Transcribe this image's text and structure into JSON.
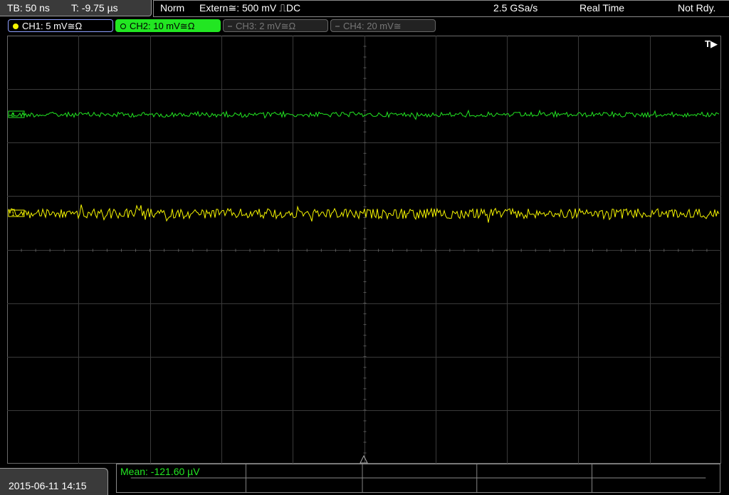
{
  "topbar": {
    "timebase": "TB: 50 ns",
    "trigger_time": "T: -9.75 µs",
    "trigger_mode": "Norm",
    "trigger_source": "Extern≅: 500 mV ⎍DC",
    "sample_rate": "2.5 GSa/s",
    "acq_mode": "Real Time",
    "status": "Not Rdy."
  },
  "channels": [
    {
      "label": "CH1: 5 mV≅Ω",
      "state": "on",
      "color": "#f5f500"
    },
    {
      "label": "CH2: 10 mV≅Ω",
      "state": "selected",
      "color": "#22e622"
    },
    {
      "label": "CH3: 2 mV≅Ω",
      "state": "off",
      "color": "#777777"
    },
    {
      "label": "CH4: 20 mV≅",
      "state": "off",
      "color": "#777777"
    }
  ],
  "screen": {
    "trigger_marker": "T▶",
    "ch1_marker": "1",
    "ch2_marker": "2"
  },
  "footer": {
    "datetime": "2015-06-11 14:15",
    "measurement": "Mean: -121.60 µV"
  },
  "colors": {
    "background": "#000000",
    "grid": "#3a3a3a",
    "ch1": "#f5f500",
    "ch2": "#22e622"
  }
}
